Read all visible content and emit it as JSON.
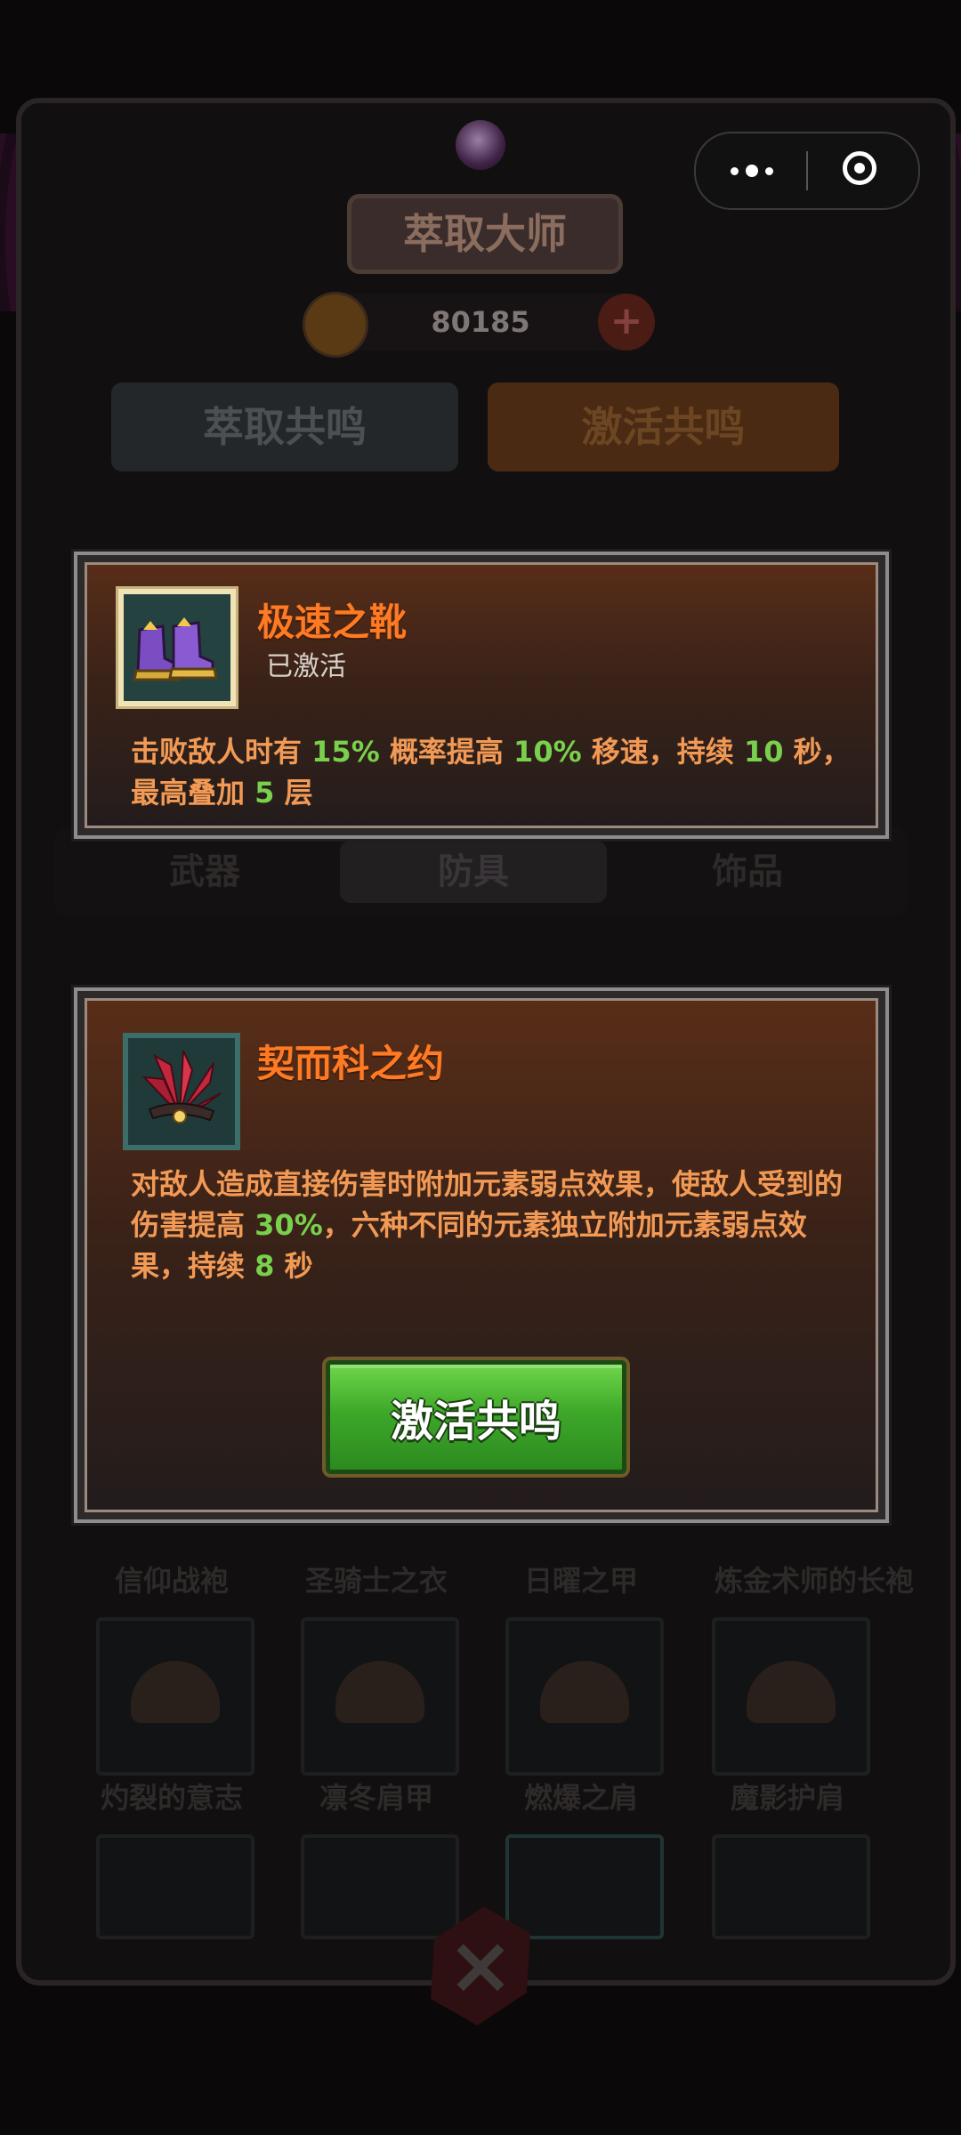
{
  "background": {
    "title": "萃取大师",
    "coins": "80185",
    "tabs": [
      "萃取共鸣",
      "激活共鸣"
    ],
    "subtabs": [
      "武器",
      "防具",
      "饰品"
    ],
    "item_names_row1": [
      "信仰战袍",
      "圣骑士之衣",
      "日曜之甲",
      "炼金术师的长袍"
    ],
    "item_names_row2": [
      "灼裂的意志",
      "凛冬肩甲",
      "燃爆之肩",
      "魔影护肩"
    ]
  },
  "card1": {
    "name": "极速之靴",
    "status": "已激活",
    "desc_parts": [
      {
        "t": "击败敌人时有 ",
        "hl": false
      },
      {
        "t": "15%",
        "hl": true
      },
      {
        "t": " 概率提高 ",
        "hl": false
      },
      {
        "t": "10%",
        "hl": true
      },
      {
        "t": " 移速，持续 ",
        "hl": false
      },
      {
        "t": "10",
        "hl": true
      },
      {
        "t": " 秒，最高叠加 ",
        "hl": false
      },
      {
        "t": "5",
        "hl": true
      },
      {
        "t": " 层",
        "hl": false
      }
    ]
  },
  "card2": {
    "name": "契而科之约",
    "desc_parts": [
      {
        "t": "对敌人造成直接伤害时附加元素弱点效果，使敌人受到的伤害提高 ",
        "hl": false
      },
      {
        "t": "30%",
        "hl": true
      },
      {
        "t": "，六种不同的元素独立附加元素弱点效果，持续 ",
        "hl": false
      },
      {
        "t": "8",
        "hl": true
      },
      {
        "t": " 秒",
        "hl": false
      }
    ],
    "button_label": "激活共鸣"
  },
  "colors": {
    "name_orange": "#ff7a22",
    "desc_orange": "#f29a55",
    "highlight_green": "#79d04c",
    "button_green": "#3ea82a"
  }
}
